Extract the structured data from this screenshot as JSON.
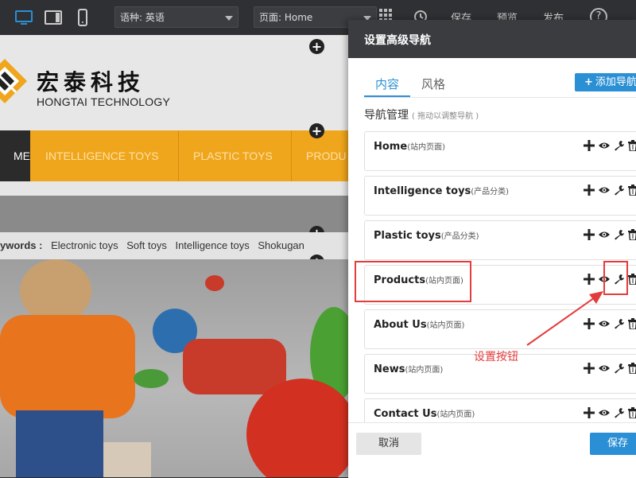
{
  "toolbar": {
    "language_select": "语种: 英语",
    "page_select": "页面: Home",
    "save_label": "保存",
    "preview_label": "预览",
    "publish_label": "发布",
    "help_label": "?"
  },
  "site": {
    "company_name_cn": "宏泰科技",
    "company_name_en": "HONGTAI TECHNOLOGY",
    "nav_items": [
      "ME",
      "INTELLIGENCE TOYS",
      "PLASTIC TOYS",
      "PRODU"
    ],
    "keywords_label": "ywords :",
    "keywords": [
      "Electronic toys",
      "Soft toys",
      "Intelligence toys",
      "Shokugan"
    ],
    "colors": {
      "accent": "#f0a61c",
      "nav_active": "#2b2b2b"
    }
  },
  "modal": {
    "title": "设置高级导航",
    "tabs": [
      {
        "label": "内容",
        "active": true
      },
      {
        "label": "风格",
        "active": false
      }
    ],
    "add_button_label": "添加导航",
    "section_title": "导航管理",
    "section_hint": "( 拖动以调整导航 )",
    "items": [
      {
        "name": "Home",
        "tag": "(站内页面)"
      },
      {
        "name": "Intelligence toys",
        "tag": "(产品分类)"
      },
      {
        "name": "Plastic toys",
        "tag": "(产品分类)"
      },
      {
        "name": "Products",
        "tag": "(站内页面)"
      },
      {
        "name": "About Us",
        "tag": "(站内页面)"
      },
      {
        "name": "News",
        "tag": "(站内页面)"
      },
      {
        "name": "Contact Us",
        "tag": "(站内页面)"
      }
    ],
    "cancel_label": "取消",
    "save_label": "保存",
    "colors": {
      "primary": "#2a8fd4",
      "header": "#3a3c40"
    }
  },
  "annotation": {
    "label": "设置按钮",
    "color": "#e33c3c"
  },
  "icons": [
    "desktop-icon",
    "tablet-icon",
    "mobile-icon",
    "grid-icon",
    "history-icon",
    "plus-icon",
    "eye-icon",
    "wrench-icon",
    "trash-icon"
  ]
}
